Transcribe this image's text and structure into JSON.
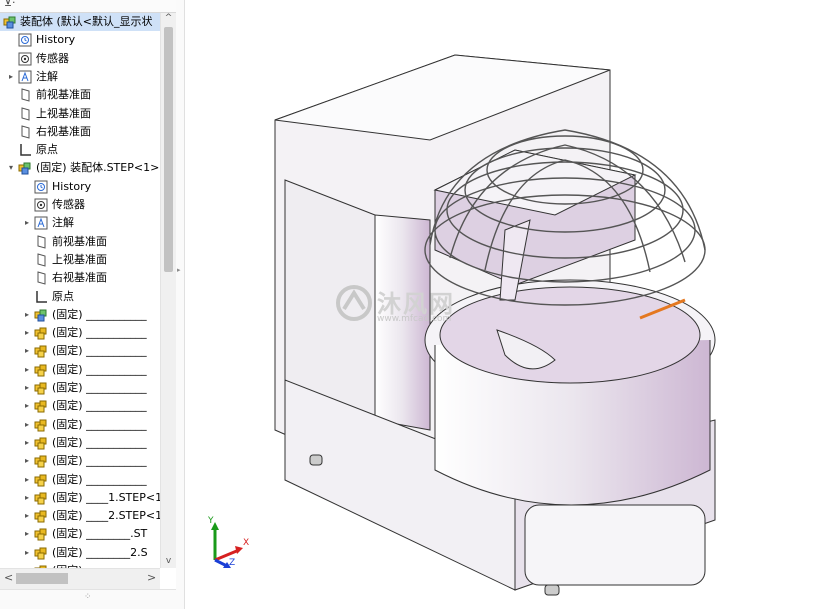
{
  "feature_tree": {
    "filter_icon": "funnel-icon",
    "rows": [
      {
        "label": "装配体 (默认<默认_显示状",
        "level": 0,
        "toggle": "",
        "icon": "assembly-icon",
        "selected": true
      },
      {
        "label": "History",
        "level": 1,
        "toggle": "",
        "icon": "history-icon"
      },
      {
        "label": "传感器",
        "level": 1,
        "toggle": "",
        "icon": "sensor-icon"
      },
      {
        "label": "注解",
        "level": 1,
        "toggle": "▸",
        "icon": "annotation-icon"
      },
      {
        "label": "前视基准面",
        "level": 1,
        "toggle": "",
        "icon": "plane-icon"
      },
      {
        "label": "上视基准面",
        "level": 1,
        "toggle": "",
        "icon": "plane-icon"
      },
      {
        "label": "右视基准面",
        "level": 1,
        "toggle": "",
        "icon": "plane-icon"
      },
      {
        "label": "原点",
        "level": 1,
        "toggle": "",
        "icon": "origin-icon"
      },
      {
        "label": "(固定) 装配体.STEP<1>",
        "level": 1,
        "toggle": "▾",
        "icon": "subassembly-icon"
      },
      {
        "label": "History",
        "level": 2,
        "toggle": "",
        "icon": "history-icon"
      },
      {
        "label": "传感器",
        "level": 2,
        "toggle": "",
        "icon": "sensor-icon"
      },
      {
        "label": "注解",
        "level": 2,
        "toggle": "▸",
        "icon": "annotation-icon"
      },
      {
        "label": "前视基准面",
        "level": 2,
        "toggle": "",
        "icon": "plane-icon"
      },
      {
        "label": "上视基准面",
        "level": 2,
        "toggle": "",
        "icon": "plane-icon"
      },
      {
        "label": "右视基准面",
        "level": 2,
        "toggle": "",
        "icon": "plane-icon"
      },
      {
        "label": "原点",
        "level": 2,
        "toggle": "",
        "icon": "origin-icon"
      },
      {
        "label": "(固定) ___________",
        "level": 2,
        "toggle": "▸",
        "icon": "subassembly-icon"
      },
      {
        "label": "(固定) ___________",
        "level": 2,
        "toggle": "▸",
        "icon": "part-icon"
      },
      {
        "label": "(固定) ___________",
        "level": 2,
        "toggle": "▸",
        "icon": "part-icon"
      },
      {
        "label": "(固定) ___________",
        "level": 2,
        "toggle": "▸",
        "icon": "part-icon"
      },
      {
        "label": "(固定) ___________",
        "level": 2,
        "toggle": "▸",
        "icon": "part-icon"
      },
      {
        "label": "(固定) ___________",
        "level": 2,
        "toggle": "▸",
        "icon": "part-icon"
      },
      {
        "label": "(固定) ___________",
        "level": 2,
        "toggle": "▸",
        "icon": "part-icon"
      },
      {
        "label": "(固定) ___________",
        "level": 2,
        "toggle": "▸",
        "icon": "part-icon"
      },
      {
        "label": "(固定) ___________",
        "level": 2,
        "toggle": "▸",
        "icon": "part-icon"
      },
      {
        "label": "(固定) ___________",
        "level": 2,
        "toggle": "▸",
        "icon": "part-icon"
      },
      {
        "label": "(固定) ____1.STEP<1",
        "level": 2,
        "toggle": "▸",
        "icon": "part-icon"
      },
      {
        "label": "(固定) ____2.STEP<1",
        "level": 2,
        "toggle": "▸",
        "icon": "part-icon"
      },
      {
        "label": "(固定) ________.ST",
        "level": 2,
        "toggle": "▸",
        "icon": "part-icon"
      },
      {
        "label": "(固定) ________2.S",
        "level": 2,
        "toggle": "▸",
        "icon": "part-icon"
      },
      {
        "label": "(固定) ___",
        "level": 2,
        "toggle": "▸",
        "icon": "part-icon"
      }
    ]
  },
  "viewport": {
    "watermark_text": "沐风网",
    "watermark_url": "www.mfcad.com",
    "triad": {
      "x": "X",
      "y": "Y",
      "z": "Z"
    }
  },
  "colors": {
    "selection": "#cfe1f7",
    "model_body": "#f0eef2",
    "model_shade": "#d9c8dd",
    "triad_x": "#d62020",
    "triad_y": "#1a9a1a",
    "triad_z": "#1a3fd6"
  }
}
